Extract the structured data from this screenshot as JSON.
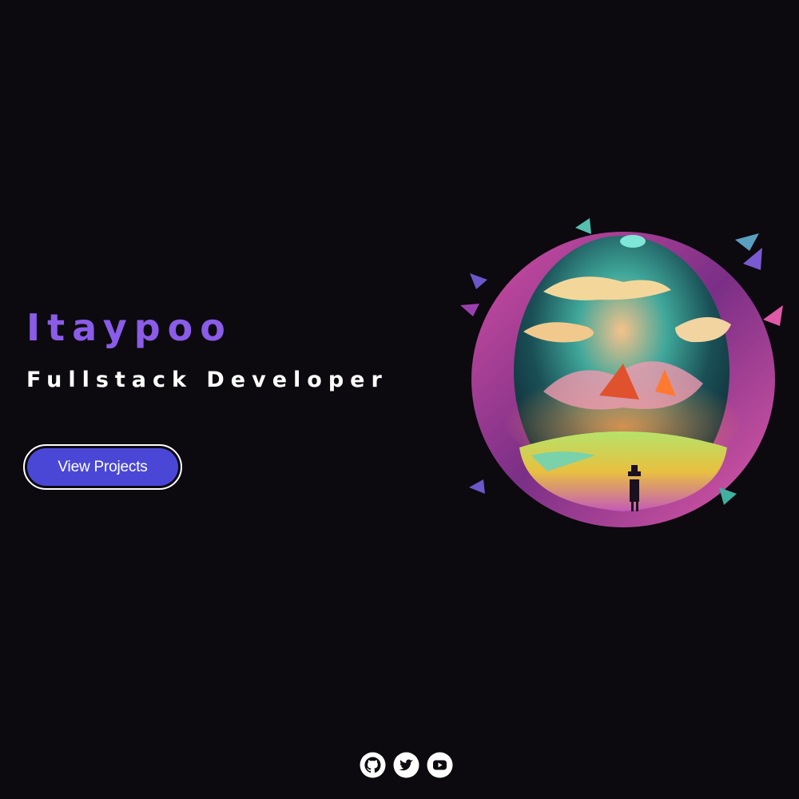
{
  "hero": {
    "name": "Itaypoo",
    "role": "Fullstack Developer",
    "cta_label": "View Projects"
  },
  "artwork": {
    "description_icon": "fantasy-portal-illustration"
  },
  "social": [
    {
      "icon": "github-icon"
    },
    {
      "icon": "twitter-icon"
    },
    {
      "icon": "youtube-icon"
    }
  ],
  "colors": {
    "background": "#0c090f",
    "name_accent": "#8a5ce8",
    "button_fill": "#4a47d6",
    "text": "#ffffff"
  }
}
